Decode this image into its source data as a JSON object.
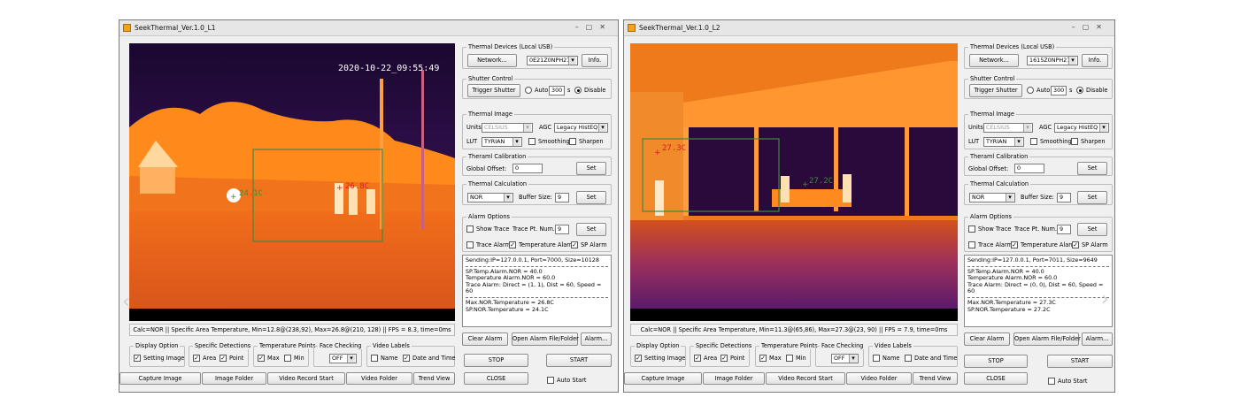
{
  "windows": [
    {
      "title": "SeekThermal_Ver.1.0_L1",
      "timestamp": "2020-10-22_09:55:49",
      "overlay": {
        "point_temp": "24.1C",
        "area_temp": "26.8C"
      },
      "calc_line": "Calc=NOR || Specific Area Temperature, Min=12.8@(238,92), Max=26.8@(210, 128) || FPS = 8.3, time=0ms",
      "devices": {
        "label": "Thermal Devices (Local USB)",
        "network_button": "Network...",
        "device_id": "0E21Z0NPH27",
        "info_button": "Info."
      },
      "shutter": {
        "label": "Shutter Control",
        "trigger_button": "Trigger Shutter",
        "auto_label": "Auto",
        "auto_value": "300",
        "unit": "s",
        "disable_label": "Disable"
      },
      "image": {
        "label": "Thermal Image",
        "units_label": "Units",
        "units_value": "CELSIUS",
        "agc_label": "AGC",
        "agc_value": "Legacy HistEQ",
        "lut_label": "LUT",
        "lut_value": "TYRIAN",
        "smoothing_label": "Smoothing",
        "sharpen_label": "Sharpen"
      },
      "calibration": {
        "label": "Theraml Calibration",
        "offset_label": "Global Offset:",
        "offset_value": "0",
        "set_button": "Set"
      },
      "calculation": {
        "label": "Thermal Calculation",
        "mode_value": "NOR",
        "buffer_label": "Buffer Size:",
        "buffer_value": "9",
        "set_button": "Set"
      },
      "alarm": {
        "label": "Alarm Options",
        "show_trace_label": "Show Trace",
        "trace_num_label": "Trace Pt. Num.:",
        "trace_num_value": "9",
        "set_button": "Set",
        "trace_alarm_label": "Trace Alarm",
        "temp_alarm_label": "Temperature Alarm",
        "sp_alarm_label": "SP Alarm"
      },
      "log": {
        "sending": "Sending:IP=127.0.0.1, Port=7000, Size=10128",
        "lines1": [
          "SP.Temp.Alarm.NOR = 40.0",
          "Temperature Alarm.NOR = 60.0",
          "Trace Alarm: Direct = (1, 1), Dist = 60, Speed = 60"
        ],
        "lines2": [
          "Max.NOR.Temperature = 26.8C",
          "SP.NOR.Temperature = 24.1C"
        ]
      },
      "alarm_buttons": {
        "clear": "Clear Alarm",
        "open_file": "Open Alarm File/Folder",
        "alarm": "Alarm..."
      },
      "display_option": {
        "label": "Display Option",
        "setting_image_label": "Setting Image"
      },
      "specific_detections": {
        "label": "Specific Detections",
        "area_label": "Area",
        "point_label": "Point"
      },
      "temperature_points": {
        "label": "Temperature Points",
        "max_label": "Max",
        "min_label": "Min"
      },
      "face_checking": {
        "label": "Face Checking",
        "value": "OFF"
      },
      "video_labels": {
        "label": "Video Labels",
        "name_label": "Name",
        "date_time_label": "Date and Time"
      },
      "bottom": {
        "capture": "Capture Image",
        "image_folder": "Image Folder",
        "video_record": "Video Record Start",
        "video_folder": "Video Folder",
        "trend_view": "Trend View"
      },
      "controls": {
        "stop": "STOP",
        "start": "START",
        "close": "CLOSE",
        "auto_start": "Auto Start"
      }
    },
    {
      "title": "SeekThermal_Ver.1.0_L2",
      "timestamp": "",
      "overlay": {
        "point_temp": "27.2C",
        "area_temp": "27.3C"
      },
      "calc_line": "Calc=NOR || Specific Area Temperature, Min=11.3@(65,86), Max=27.3@(23, 90) || FPS = 7.9, time=0ms",
      "devices": {
        "label": "Thermal Devices (Local USB)",
        "network_button": "Network...",
        "device_id": "1615Z0NPH27",
        "info_button": "Info."
      },
      "shutter": {
        "label": "Shutter Control",
        "trigger_button": "Trigger Shutter",
        "auto_label": "Auto",
        "auto_value": "300",
        "unit": "s",
        "disable_label": "Disable"
      },
      "image": {
        "label": "Thermal Image",
        "units_label": "Units",
        "units_value": "CELSIUS",
        "agc_label": "AGC",
        "agc_value": "Legacy HistEQ",
        "lut_label": "LUT",
        "lut_value": "TYRIAN",
        "smoothing_label": "Smoothing",
        "sharpen_label": "Sharpen"
      },
      "calibration": {
        "label": "Theraml Calibration",
        "offset_label": "Global Offset:",
        "offset_value": "0",
        "set_button": "Set"
      },
      "calculation": {
        "label": "Thermal Calculation",
        "mode_value": "NOR",
        "buffer_label": "Buffer Size:",
        "buffer_value": "9",
        "set_button": "Set"
      },
      "alarm": {
        "label": "Alarm Options",
        "show_trace_label": "Show Trace",
        "trace_num_label": "Trace Pt. Num.:",
        "trace_num_value": "9",
        "set_button": "Set",
        "trace_alarm_label": "Trace Alarm",
        "temp_alarm_label": "Temperature Alarm",
        "sp_alarm_label": "SP Alarm"
      },
      "log": {
        "sending": "Sending:IP=127.0.0.1, Port=7011, Size=9649",
        "lines1": [
          "SP.Temp.Alarm.NOR = 40.0",
          "Temperature Alarm.NOR = 60.0",
          "Trace Alarm: Direct = (0, 0), Dist = 60, Speed = 60"
        ],
        "lines2": [
          "Max.NOR.Temperature = 27.3C",
          "SP.NOR.Temperature = 27.2C"
        ]
      },
      "alarm_buttons": {
        "clear": "Clear Alarm",
        "open_file": "Open Alarm File/Folder",
        "alarm": "Alarm..."
      },
      "display_option": {
        "label": "Display Option",
        "setting_image_label": "Setting Image"
      },
      "specific_detections": {
        "label": "Specific Detections",
        "area_label": "Area",
        "point_label": "Point"
      },
      "temperature_points": {
        "label": "Temperature Points",
        "max_label": "Max",
        "min_label": "Min"
      },
      "face_checking": {
        "label": "Face Checking",
        "value": "OFF"
      },
      "video_labels": {
        "label": "Video Labels",
        "name_label": "Name",
        "date_time_label": "Date and Time"
      },
      "bottom": {
        "capture": "Capture Image",
        "image_folder": "Image Folder",
        "video_record": "Video Record Start",
        "video_folder": "Video Folder",
        "trend_view": "Trend View"
      },
      "controls": {
        "stop": "STOP",
        "start": "START",
        "close": "CLOSE",
        "auto_start": "Auto Start"
      }
    }
  ],
  "icons": {
    "window_buttons": "minimize-maximize-close-icons",
    "nav_prev": "chevron-left-icon",
    "nav_next": "chevron-right-icon"
  },
  "colors": {
    "thermal_hot": "#ff8a1c",
    "thermal_warm": "#e0521c",
    "thermal_cool": "#6a1f7a",
    "overlay_green": "#2e7d32"
  }
}
